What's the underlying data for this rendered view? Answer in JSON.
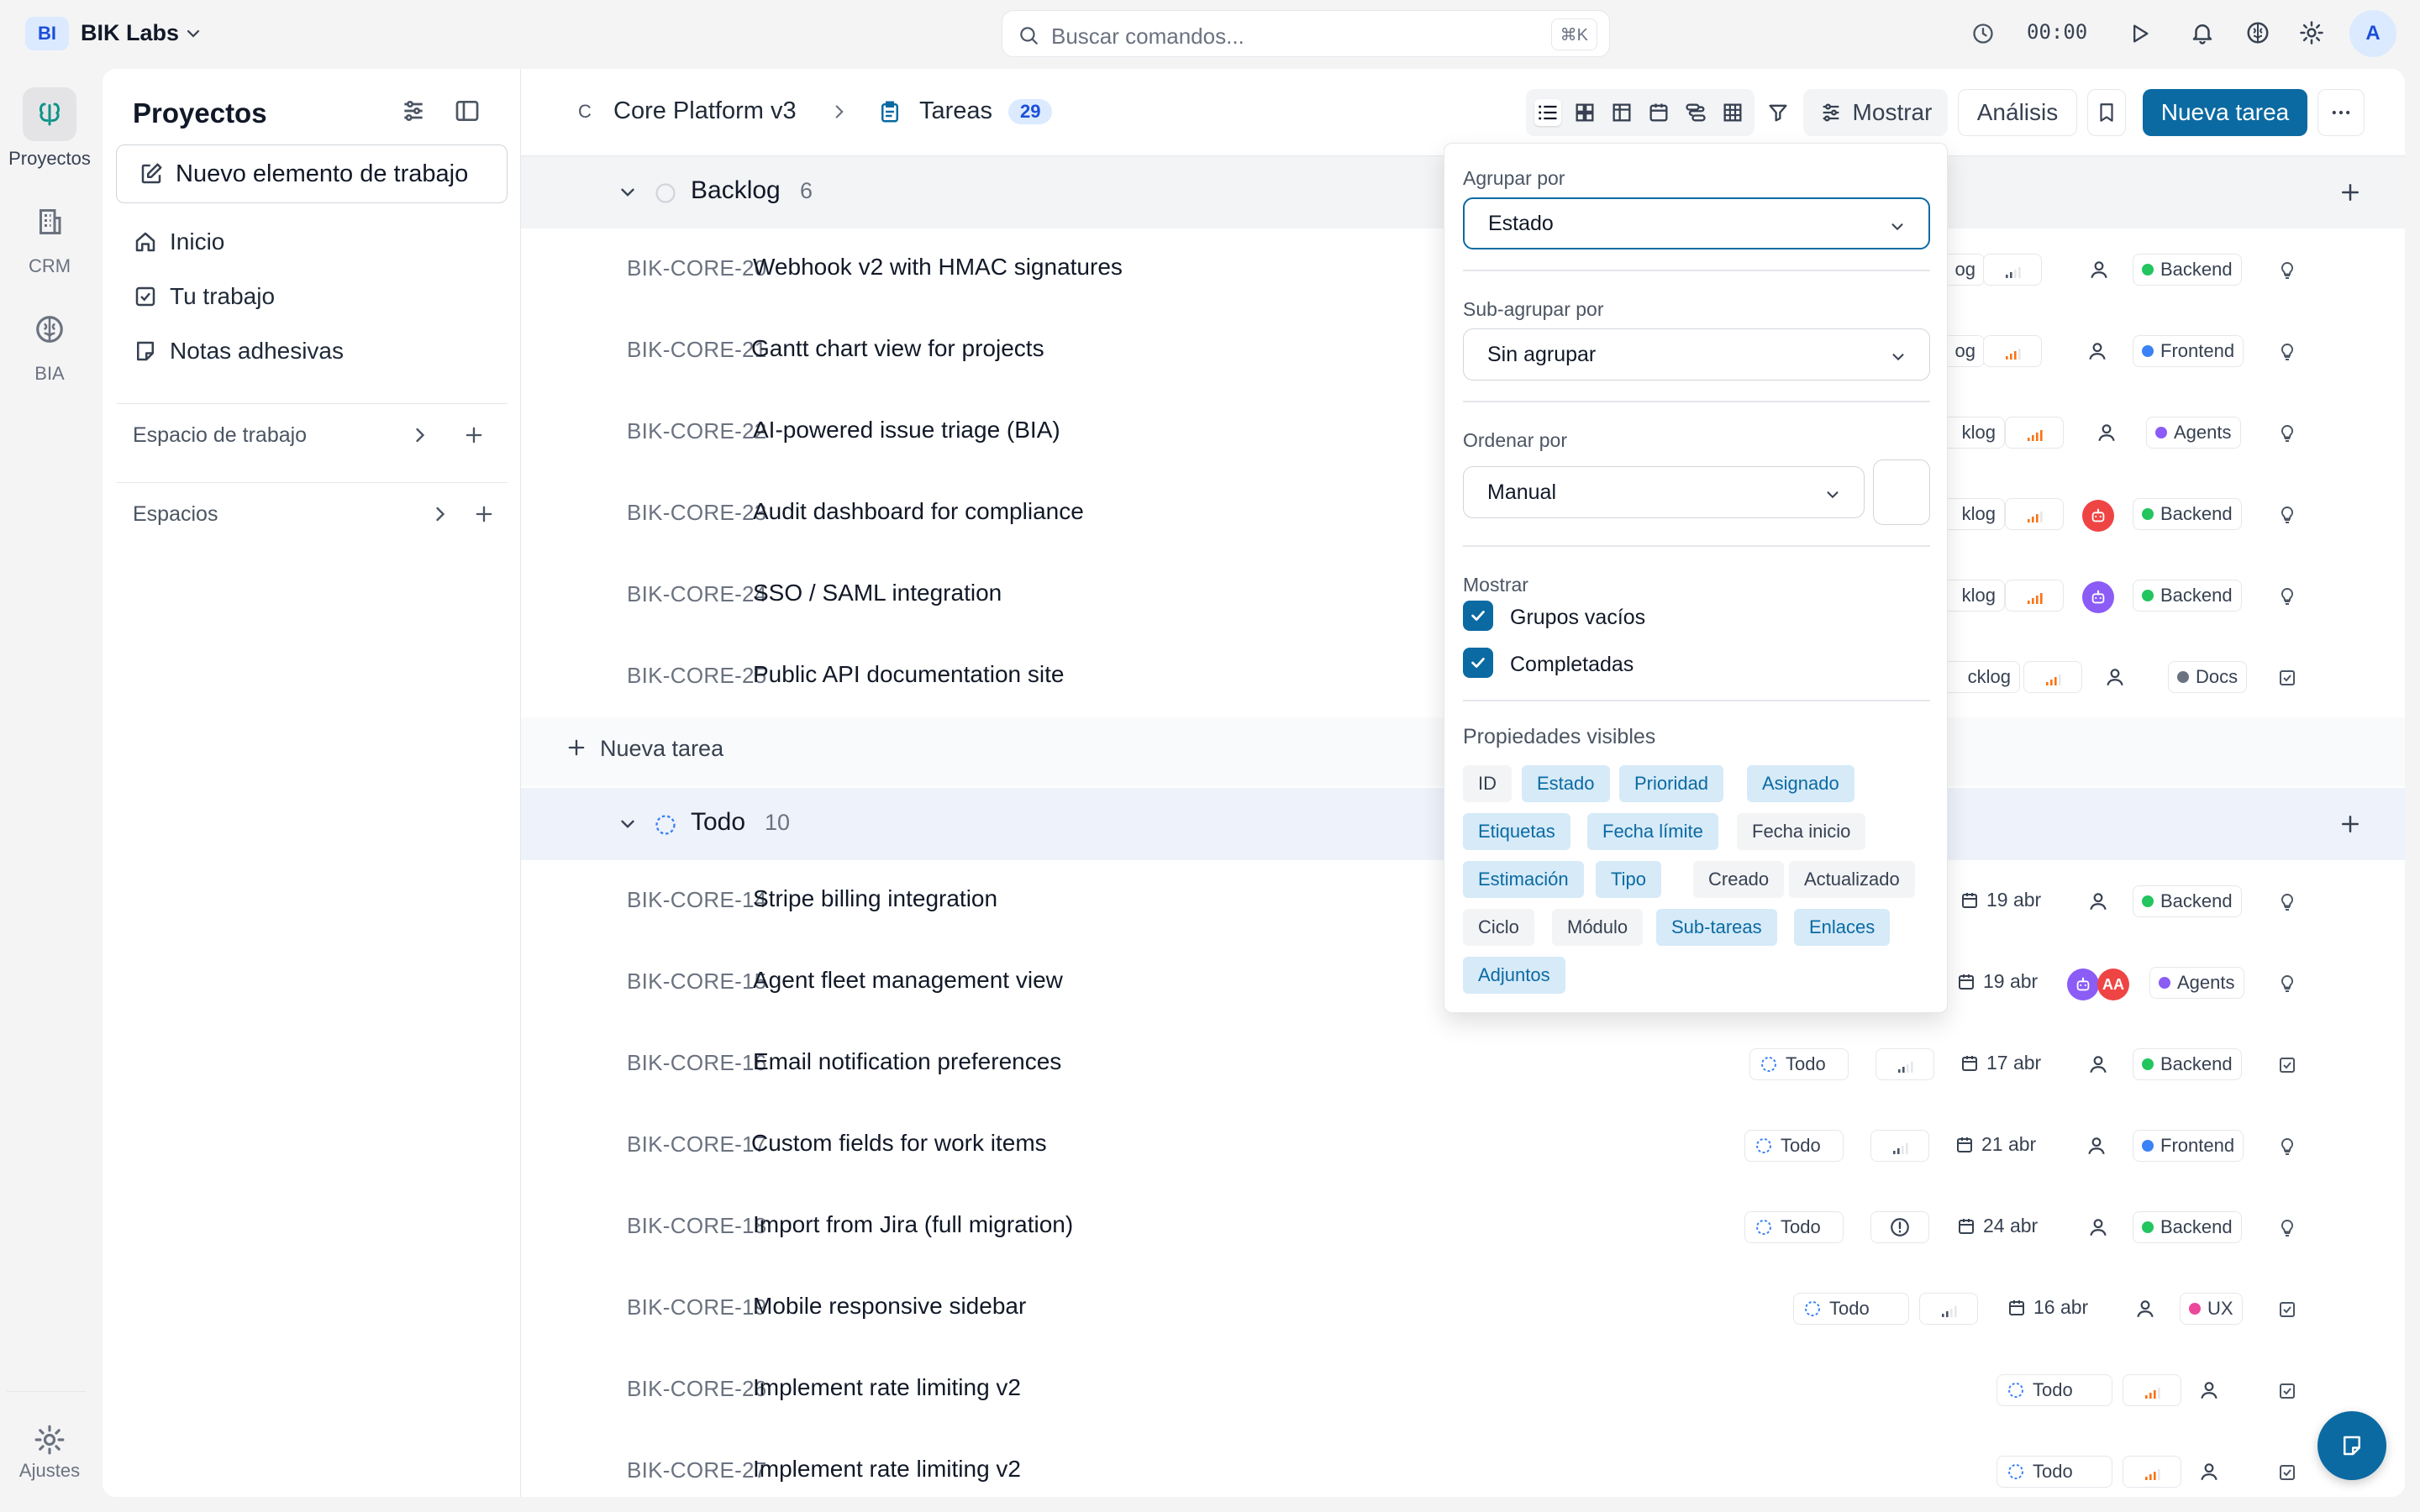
{
  "workspace": {
    "initials": "BI",
    "name": "BIK Labs"
  },
  "search": {
    "placeholder": "Buscar comandos...",
    "shortcut": "⌘K"
  },
  "timer": "00:00",
  "user": {
    "initial": "A"
  },
  "rail": {
    "items": [
      {
        "label": "Proyectos"
      },
      {
        "label": "CRM"
      },
      {
        "label": "BIA"
      }
    ],
    "settings": "Ajustes"
  },
  "sidebar": {
    "title": "Proyectos",
    "new_item": "Nuevo elemento de trabajo",
    "nav": [
      {
        "label": "Inicio"
      },
      {
        "label": "Tu trabajo"
      },
      {
        "label": "Notas adhesivas"
      }
    ],
    "workspace_section": "Espacio de trabajo",
    "spaces_section": "Espacios"
  },
  "header": {
    "project_initial": "C",
    "project": "Core Platform v3",
    "page": "Tareas",
    "count": "29",
    "display_btn": "Mostrar",
    "analysis_btn": "Análisis",
    "new_task_btn": "Nueva tarea"
  },
  "groups": [
    {
      "name": "Backlog",
      "count": "6",
      "rows": [
        {
          "id": "BIK-CORE-20",
          "title": "Webhook v2 with HMAC signatures",
          "state_frag": "og",
          "label": "Backend",
          "label_color": "#22c55e"
        },
        {
          "id": "BIK-CORE-21",
          "title": "Gantt chart view for projects",
          "state_frag": "og",
          "label": "Frontend",
          "label_color": "#3b82f6"
        },
        {
          "id": "BIK-CORE-22",
          "title": "AI-powered issue triage (BIA)",
          "state_frag": "klog",
          "label": "Agents",
          "label_color": "#8b5cf6"
        },
        {
          "id": "BIK-CORE-23",
          "title": "Audit dashboard for compliance",
          "state_frag": "klog",
          "label": "Backend",
          "label_color": "#22c55e"
        },
        {
          "id": "BIK-CORE-24",
          "title": "SSO / SAML integration",
          "state_frag": "klog",
          "label": "Backend",
          "label_color": "#22c55e"
        },
        {
          "id": "BIK-CORE-25",
          "title": "Public API documentation site",
          "state_frag": "cklog",
          "label": "Docs",
          "label_color": "#6b7280"
        }
      ],
      "add_label": "Nueva tarea"
    },
    {
      "name": "Todo",
      "count": "10",
      "rows": [
        {
          "id": "BIK-CORE-14",
          "title": "Stripe billing integration",
          "date": "19 abr",
          "label": "Backend",
          "label_color": "#22c55e"
        },
        {
          "id": "BIK-CORE-15",
          "title": "Agent fleet management view",
          "date": "19 abr",
          "label": "Agents",
          "label_color": "#8b5cf6",
          "assignee_initials": "AA"
        },
        {
          "id": "BIK-CORE-16",
          "title": "Email notification preferences",
          "state": "Todo",
          "date": "17 abr",
          "label": "Backend",
          "label_color": "#22c55e"
        },
        {
          "id": "BIK-CORE-17",
          "title": "Custom fields for work items",
          "state": "Todo",
          "date": "21 abr",
          "label": "Frontend",
          "label_color": "#3b82f6"
        },
        {
          "id": "BIK-CORE-18",
          "title": "Import from Jira (full migration)",
          "state": "Todo",
          "date": "24 abr",
          "label": "Backend",
          "label_color": "#22c55e"
        },
        {
          "id": "BIK-CORE-19",
          "title": "Mobile responsive sidebar",
          "state": "Todo",
          "date": "16 abr",
          "label": "UX",
          "label_color": "#ec4899"
        },
        {
          "id": "BIK-CORE-26",
          "title": "Implement rate limiting v2",
          "state": "Todo"
        },
        {
          "id": "BIK-CORE-27",
          "title": "Implement rate limiting v2",
          "state": "Todo"
        }
      ]
    }
  ],
  "display_popup": {
    "group_by_label": "Agrupar por",
    "group_by_value": "Estado",
    "subgroup_label": "Sub-agrupar por",
    "subgroup_value": "Sin agrupar",
    "order_label": "Ordenar por",
    "order_value": "Manual",
    "show_label": "Mostrar",
    "checkboxes": [
      {
        "label": "Grupos vacíos",
        "checked": true
      },
      {
        "label": "Completadas",
        "checked": true
      }
    ],
    "properties_label": "Propiedades visibles",
    "properties": [
      {
        "label": "ID",
        "active": false
      },
      {
        "label": "Estado",
        "active": true
      },
      {
        "label": "Prioridad",
        "active": true
      },
      {
        "label": "Asignado",
        "active": true
      },
      {
        "label": "Etiquetas",
        "active": true
      },
      {
        "label": "Fecha límite",
        "active": true
      },
      {
        "label": "Fecha inicio",
        "active": false
      },
      {
        "label": "Estimación",
        "active": true
      },
      {
        "label": "Tipo",
        "active": true
      },
      {
        "label": "Creado",
        "active": false
      },
      {
        "label": "Actualizado",
        "active": false
      },
      {
        "label": "Ciclo",
        "active": false
      },
      {
        "label": "Módulo",
        "active": false
      },
      {
        "label": "Sub-tareas",
        "active": true
      },
      {
        "label": "Enlaces",
        "active": true
      },
      {
        "label": "Adjuntos",
        "active": true
      }
    ]
  },
  "colors": {
    "accent": "#0b6aa2",
    "badge_bg": "#dbeafe",
    "todo_status": "#3b82f6"
  }
}
